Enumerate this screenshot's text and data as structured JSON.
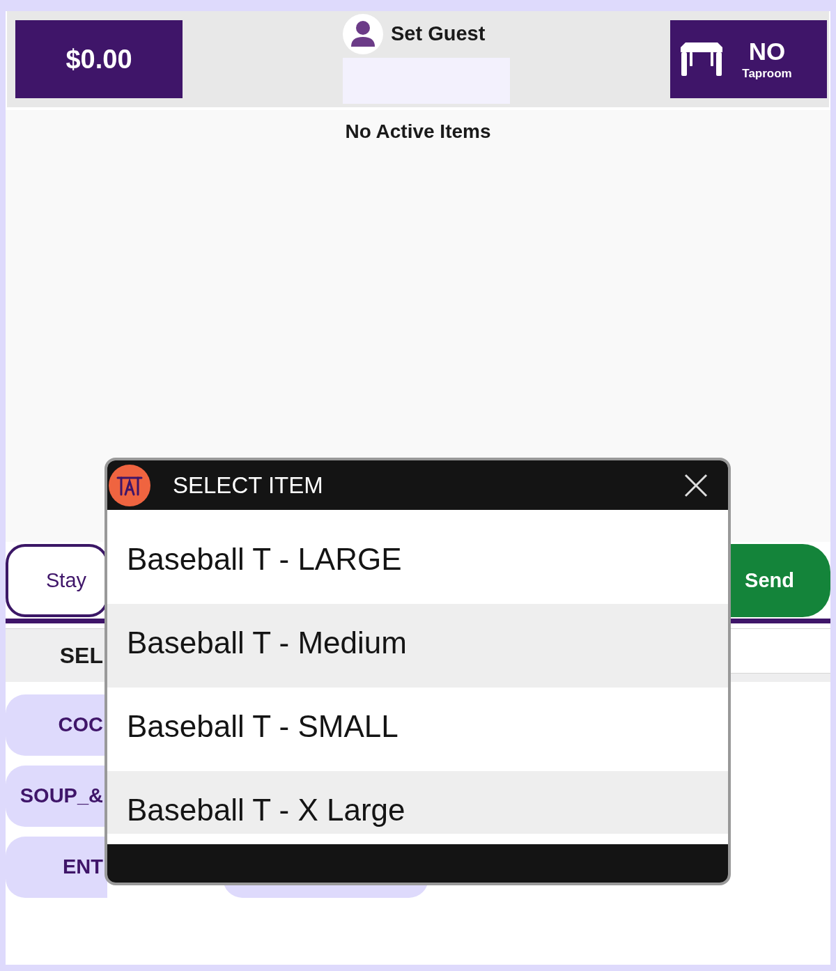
{
  "header": {
    "total": "$0.00",
    "guest": {
      "label": "Set Guest"
    },
    "table": {
      "number": "NO",
      "area": "Taproom"
    }
  },
  "order": {
    "message": "No Active Items"
  },
  "actions": [
    {
      "kind": "stay",
      "label": "Stay"
    },
    {
      "kind": "send",
      "label": "Send"
    }
  ],
  "section": {
    "title": "SEL"
  },
  "categories": [
    {
      "kind": "labeled",
      "label": "COC"
    },
    {
      "kind": "labeled",
      "label": "SOUP_&"
    },
    {
      "kind": "labeled",
      "label": "ENT"
    },
    {
      "kind": "covered"
    }
  ],
  "modal": {
    "title": "SELECT ITEM",
    "items": [
      {
        "label": "Baseball T - LARGE"
      },
      {
        "label": "Baseball T - Medium"
      },
      {
        "label": "Baseball T - SMALL"
      },
      {
        "label": "Baseball T - X Large"
      }
    ]
  }
}
